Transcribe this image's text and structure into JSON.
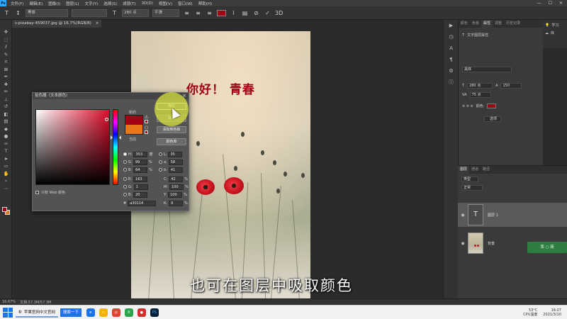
{
  "menubar": {
    "items": [
      "文件(F)",
      "编辑(E)",
      "图像(I)",
      "图层(L)",
      "文字(Y)",
      "选择(S)",
      "滤镜(T)",
      "3D(D)",
      "视图(V)",
      "窗口(W)",
      "帮助(H)"
    ]
  },
  "options": {
    "font_family": "黑体",
    "font_size": "280 点",
    "antialias": "平滑"
  },
  "document": {
    "tab_title": "s-pixabay-459037.jpg @ 16.7%(RGB/8)",
    "tab_close": "×"
  },
  "canvas": {
    "text": "你好！ 青春"
  },
  "subtitle": {
    "text": "也可在图层中吸取颜色"
  },
  "picker": {
    "title": "拾色器（文本颜色）",
    "new_label": "新的",
    "current_label": "当前",
    "ok_label": "确定",
    "cancel_label": "取消",
    "add_swatch_label": "添加到色板",
    "library_label": "颜色库",
    "web_only_label": "只有 Web 颜色",
    "hex_prefix": "#",
    "hex_value": "a30114",
    "fields": {
      "H": {
        "label": "H:",
        "value": "353",
        "unit": "度"
      },
      "S": {
        "label": "S:",
        "value": "99",
        "unit": "%"
      },
      "Bv": {
        "label": "B:",
        "value": "64",
        "unit": "%"
      },
      "R": {
        "label": "R:",
        "value": "163",
        "unit": ""
      },
      "G": {
        "label": "G:",
        "value": "1",
        "unit": ""
      },
      "Bl": {
        "label": "B:",
        "value": "20",
        "unit": ""
      },
      "L": {
        "label": "L:",
        "value": "35"
      },
      "a": {
        "label": "a:",
        "value": "58"
      },
      "b": {
        "label": "b:",
        "value": "41"
      },
      "C": {
        "label": "C:",
        "value": "42",
        "unit": "%"
      },
      "M": {
        "label": "M:",
        "value": "100",
        "unit": "%"
      },
      "Y": {
        "label": "Y:",
        "value": "100",
        "unit": "%"
      },
      "K": {
        "label": "K:",
        "value": "9",
        "unit": "%"
      }
    },
    "new_color": "#a30114",
    "current_color": "#e8761a"
  },
  "properties": {
    "tabs": [
      "颜色",
      "色板",
      "属性",
      "调整",
      "历史记录"
    ],
    "active_tab": "属性",
    "header": "文字图层属性",
    "font_family": "黑体",
    "font_size": "280 点",
    "leading": "150",
    "tracking": "75 点",
    "color_label": "颜色:",
    "more_button": "选项"
  },
  "learn": {
    "learn_label": "学习",
    "library_label": "库"
  },
  "layers": {
    "tabs": [
      "图层",
      "通道",
      "路径"
    ],
    "active_tab": "图层",
    "search_label": "类型",
    "blend_mode": "正常",
    "rows": [
      {
        "name": "图层 1",
        "thumb": "T"
      },
      {
        "name": "背景",
        "thumb": "photo"
      }
    ]
  },
  "statusbar": {
    "zoom": "16.67%",
    "doc": "文档:57.3M/57.3M"
  },
  "taskbar": {
    "tasks": [
      "苹果官网中文官网",
      "PS"
    ],
    "search_label": "搜索一下",
    "weather": "53°C",
    "weather_sub": "CPU温度",
    "time": "16:27",
    "date": "2021/3/10"
  },
  "watermark": {
    "text": "率 ○ 简"
  },
  "colors": {
    "accent_red": "#a30114",
    "background_orange": "#e8761a",
    "ps_blue": "#31a8ff"
  }
}
